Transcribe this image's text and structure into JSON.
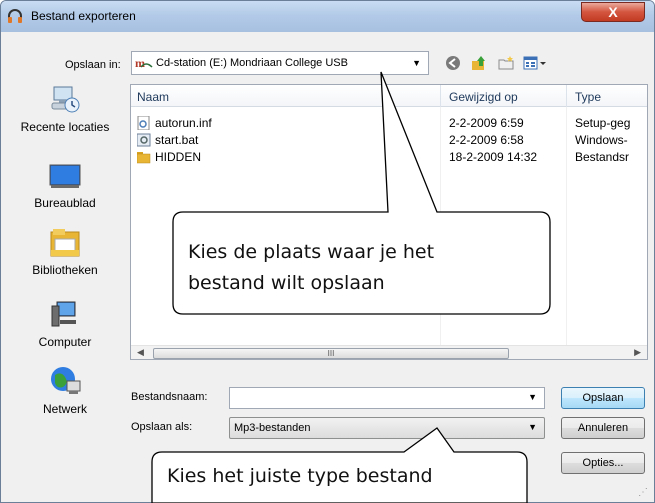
{
  "window": {
    "title": "Bestand exporteren",
    "close_label": "X"
  },
  "lookin": {
    "label": "Opslaan in:",
    "value": "Cd-station (E:) Mondriaan College USB"
  },
  "places": [
    {
      "label": "Recente locaties",
      "icon": "recent-places-icon"
    },
    {
      "label": "Bureaublad",
      "icon": "desktop-icon"
    },
    {
      "label": "Bibliotheken",
      "icon": "libraries-icon"
    },
    {
      "label": "Computer",
      "icon": "computer-icon"
    },
    {
      "label": "Netwerk",
      "icon": "network-icon"
    }
  ],
  "filelist": {
    "columns": [
      "Naam",
      "Gewijzigd op",
      "Type"
    ],
    "rows": [
      {
        "name": "autorun.inf",
        "modified": "2-2-2009 6:59",
        "type": "Setup-geg",
        "icon": "settings-file-icon"
      },
      {
        "name": "start.bat",
        "modified": "2-2-2009 6:58",
        "type": "Windows-",
        "icon": "batch-file-icon"
      },
      {
        "name": "HIDDEN",
        "modified": "18-2-2009 14:32",
        "type": "Bestandsr",
        "icon": "folder-icon"
      }
    ],
    "scroll_thumb": "III"
  },
  "filename": {
    "label": "Bestandsnaam:",
    "value": ""
  },
  "filetype": {
    "label": "Opslaan als:",
    "value": "Mp3-bestanden"
  },
  "buttons": {
    "save": "Opslaan",
    "cancel": "Annuleren",
    "options": "Opties..."
  },
  "callouts": {
    "location_line1": "Kies de plaats waar je het",
    "location_line2": "bestand wilt opslaan",
    "type": "Kies het juiste type bestand"
  },
  "colors": {
    "accent": "#3c7fb1",
    "close": "#c23b22",
    "folder": "#e8b534"
  }
}
